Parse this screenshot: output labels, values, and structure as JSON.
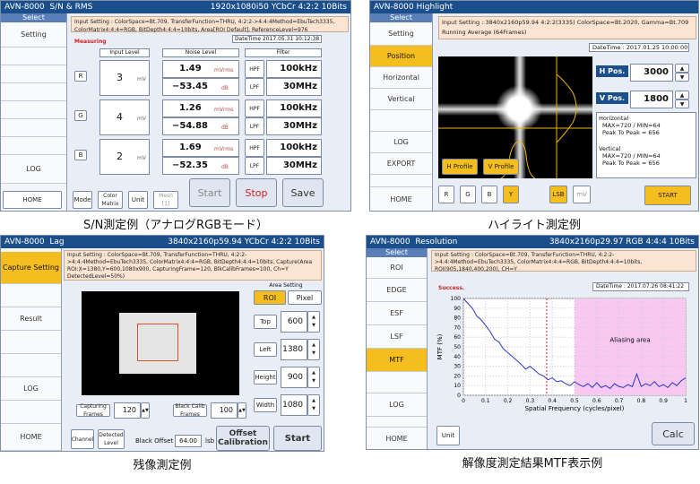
{
  "panels": {
    "sn": {
      "app": "AVN-8000",
      "mode": "S/N & RMS",
      "fmt": "1920x1080i50 YCbCr 4:2:2 10Bits",
      "select": "Select",
      "side": [
        "Setting",
        "",
        "",
        "",
        "",
        "",
        "",
        "LOG"
      ],
      "info": "Input Setting : ColorSpace=Bt.709, TransferFunction=THRU, 4:2:2->4:4:4Method=EbuTech3335, ColorMatrix4:4:4=RGB, BitDepth4:4:4=10bits, Area[ROI Default], ReferenceLevel=976",
      "status": "Measuring",
      "datetime": "DateTime 2017.05.31 10:12:38",
      "hdr": {
        "input": "Input Level",
        "noise": "Noise Level",
        "filter": "Filter"
      },
      "rows": [
        {
          "ch": "R",
          "lvl": "3",
          "lu": "mV",
          "n1": "1.49",
          "n1u": "mVrms",
          "n2": "−53.45",
          "n2u": "dB",
          "hpf": "HPF",
          "hv": "100kHz",
          "lpf": "LPF",
          "lv": "30MHz"
        },
        {
          "ch": "G",
          "lvl": "4",
          "lu": "mV",
          "n1": "1.26",
          "n1u": "mVrms",
          "n2": "−54.88",
          "n2u": "dB",
          "hpf": "HPF",
          "hv": "100kHz",
          "lpf": "LPF",
          "lv": "30MHz"
        },
        {
          "ch": "B",
          "lvl": "2",
          "lu": "mV",
          "n1": "1.69",
          "n1u": "mVrms",
          "n2": "−52.35",
          "n2u": "dB",
          "hpf": "HPF",
          "hv": "100kHz",
          "lpf": "LPF",
          "lv": "30MHz"
        }
      ],
      "home": "HOME",
      "mode_btn": "Mode",
      "color": "Color Matrix",
      "unit": "Unit",
      "mesh": "Mesh [1]",
      "start": "Start",
      "stop": "Stop",
      "save": "Save"
    },
    "hl": {
      "app": "AVN-8000",
      "mode": "Highlight",
      "select": "Select",
      "side": [
        "Setting",
        "Position",
        "Horizontal",
        "Vertical",
        "",
        "LOG",
        "EXPORT",
        "",
        "HOME"
      ],
      "info": "Input Setting : 3840x2160p59.94 4:2:2(3335) ColorSpace=Bt.2020, Gamma=Bt.709 Running Average (64Frames)",
      "datetime": "DateTime : 2017.01.25 10:00:00",
      "hpos_label": "H Pos.",
      "hpos": "3000",
      "vpos_label": "V Pos.",
      "vpos": "1800",
      "hres": [
        "Horizontal",
        "MAX=720 / MIN=64",
        "Peak To Peak = 656"
      ],
      "vres": [
        "Vertical",
        "MAX=720 / MIN=64",
        "Peak To Peak = 656"
      ],
      "hprof": "H Profile",
      "vprof": "V Profile",
      "chans": [
        "R",
        "G",
        "B",
        "Y"
      ],
      "lsb": "LSB",
      "mv": "mV",
      "start": "START"
    },
    "lag": {
      "app": "AVN-8000",
      "mode": "Lag",
      "fmt": "3840x2160p59.94 YCbCr 4:2:2 10Bits",
      "side": [
        "Capture Setting",
        "",
        "Result",
        "",
        "",
        "LOG",
        "",
        "HOME"
      ],
      "info": "Input Setting : ColorSpace=Bt.709, TransferFunction=THRU, 4:2:2->4:4:4Method=EbuTech3335, ColorMatrix4:4:4=RGB, BitDepth4:4:4=10bits, Capture(Area ROI:X=1380,Y=600,1080x900, CapturingFrame=120, BlkCalibFrames=100, Ch=Y DetectedLevel=50%)",
      "area": "Area Setting",
      "roi": "ROI",
      "pixel": "Pixel",
      "fields": [
        {
          "l": "Top",
          "v": "600"
        },
        {
          "l": "Left",
          "v": "1380"
        },
        {
          "l": "Height",
          "v": "900"
        },
        {
          "l": "Width",
          "v": "1080"
        }
      ],
      "capf": "Capturing Frames",
      "capv": "120",
      "blk": "Black Calib Frames",
      "blkv": "100",
      "channel": "Channel",
      "detected": "Detected Level",
      "offset_l": "Black Offset",
      "offset_v": "64.00",
      "lsb": "lsb",
      "offcal": "Offset Calibration",
      "start": "Start"
    },
    "mtf": {
      "app": "AVN-8000",
      "mode": "Resolution",
      "fmt": "3840x2160p29.97 RGB 4:4:4 10Bits",
      "select": "Select",
      "side": [
        "ROI",
        "EDGE",
        "ESF",
        "LSF",
        "MTF",
        "",
        "LOG",
        "",
        "HOME"
      ],
      "info": "Input Setting : ColorSpace=Bt.709, TransferFunction=THRU, 4:2:2->4:4:4Method=EbuTech3335, ColorMatrix4:4:4=RGB, BitDepth4:4:4=10bits, ROI(905,1840,400,200), CH=Y",
      "status": "Success.",
      "datetime": "DateTime : 2017.07.26 08:41:22",
      "unit": "Unit",
      "calc": "Calc",
      "alias": "Aliasing area"
    }
  },
  "captions": [
    "S/N測定例（アナログRGBモード）",
    "ハイライト測定例",
    "残像測定例",
    "解像度測定結果MTF表示例"
  ],
  "chart_data": {
    "type": "line",
    "xlabel": "Spatial Frequency (cycles/pixel)",
    "ylabel": "MTF (%)",
    "xlim": [
      0,
      1
    ],
    "ylim": [
      0,
      100
    ],
    "xticks": [
      "0",
      "0.1",
      "0.2",
      "0.3",
      "0.4",
      "0.5",
      "0.6",
      "0.7",
      "0.8",
      "0.9",
      "1"
    ],
    "yticks": [
      "0",
      "10",
      "20",
      "30",
      "40",
      "50",
      "60",
      "70",
      "80",
      "90",
      "100"
    ],
    "grid": true,
    "aliasing_from": 0.5,
    "marker_x": 0.375,
    "x": [
      0,
      0.02,
      0.04,
      0.06,
      0.08,
      0.1,
      0.12,
      0.14,
      0.16,
      0.18,
      0.2,
      0.22,
      0.24,
      0.26,
      0.28,
      0.3,
      0.32,
      0.34,
      0.36,
      0.38,
      0.4,
      0.42,
      0.44,
      0.46,
      0.48,
      0.5,
      0.52,
      0.54,
      0.56,
      0.58,
      0.6,
      0.62,
      0.64,
      0.66,
      0.68,
      0.7,
      0.72,
      0.74,
      0.76,
      0.78,
      0.8,
      0.82,
      0.84,
      0.86,
      0.88,
      0.9,
      0.92,
      0.94,
      0.96,
      0.98,
      1.0
    ],
    "y": [
      100,
      95,
      90,
      82,
      78,
      72,
      66,
      58,
      55,
      48,
      44,
      40,
      36,
      32,
      27,
      30,
      26,
      22,
      20,
      16,
      18,
      14,
      15,
      12,
      10,
      14,
      11,
      9,
      12,
      8,
      13,
      8,
      10,
      7,
      12,
      9,
      8,
      11,
      9,
      22,
      9,
      12,
      10,
      14,
      9,
      11,
      8,
      13,
      10,
      15,
      18
    ]
  }
}
